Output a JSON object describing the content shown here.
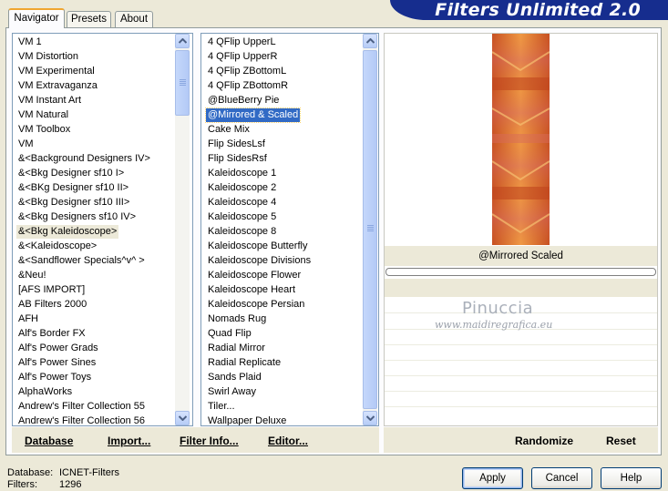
{
  "tabs": [
    {
      "label": "Navigator",
      "active": true
    },
    {
      "label": "Presets",
      "active": false
    },
    {
      "label": "About",
      "active": false
    }
  ],
  "title": "Filters Unlimited 2.0",
  "categories": {
    "items": [
      "VM 1",
      "VM Distortion",
      "VM Experimental",
      "VM Extravaganza",
      "VM Instant Art",
      "VM Natural",
      "VM Toolbox",
      "VM",
      "&<Background Designers IV>",
      "&<Bkg Designer sf10 I>",
      "&<BKg Designer sf10 II>",
      "&<Bkg Designer sf10 III>",
      "&<Bkg Designers sf10 IV>",
      "&<Bkg Kaleidoscope>",
      "&<Kaleidoscope>",
      "&<Sandflower Specials^v^ >",
      "&Neu!",
      "[AFS IMPORT]",
      "AB Filters 2000",
      "AFH",
      "Alf's Border FX",
      "Alf's Power Grads",
      "Alf's Power Sines",
      "Alf's Power Toys",
      "AlphaWorks",
      "Andrew's Filter Collection 55",
      "Andrew's Filter Collection 56"
    ],
    "highlighted": "&<Bkg Kaleidoscope>"
  },
  "filters": {
    "items": [
      "4 QFlip UpperL",
      "4 QFlip UpperR",
      "4 QFlip ZBottomL",
      "4 QFlip ZBottomR",
      "@BlueBerry Pie",
      "@Mirrored & Scaled",
      "Cake Mix",
      "Flip SidesLsf",
      "Flip SidesRsf",
      "Kaleidoscope 1",
      "Kaleidoscope 2",
      "Kaleidoscope 4",
      "Kaleidoscope 5",
      "Kaleidoscope 8",
      "Kaleidoscope Butterfly",
      "Kaleidoscope Divisions",
      "Kaleidoscope Flower",
      "Kaleidoscope Heart",
      "Kaleidoscope Persian",
      "Nomads Rug",
      "Quad Flip",
      "Radial Mirror",
      "Radial Replicate",
      "Sands Plaid",
      "Swirl Away",
      "Tiler...",
      "Wallpaper Deluxe"
    ],
    "selected": "@Mirrored & Scaled"
  },
  "actions": {
    "database": "Database",
    "import": "Import...",
    "filter_info": "Filter Info...",
    "editor": "Editor..."
  },
  "preview": {
    "filter_name": "@Mirrored  Scaled",
    "randomize": "Randomize",
    "reset": "Reset",
    "watermark_name": "Pinuccia",
    "watermark_url": "www.maidiregrafica.eu",
    "colors": {
      "dark": "#c0451e",
      "mid": "#e27a2e",
      "light": "#f2a049",
      "pink": "#d86a5a"
    }
  },
  "status": {
    "database_label": "Database:",
    "database_value": "ICNET-Filters",
    "filters_label": "Filters:",
    "filters_value": "1296"
  },
  "buttons": {
    "apply": "Apply",
    "cancel": "Cancel",
    "help": "Help"
  }
}
